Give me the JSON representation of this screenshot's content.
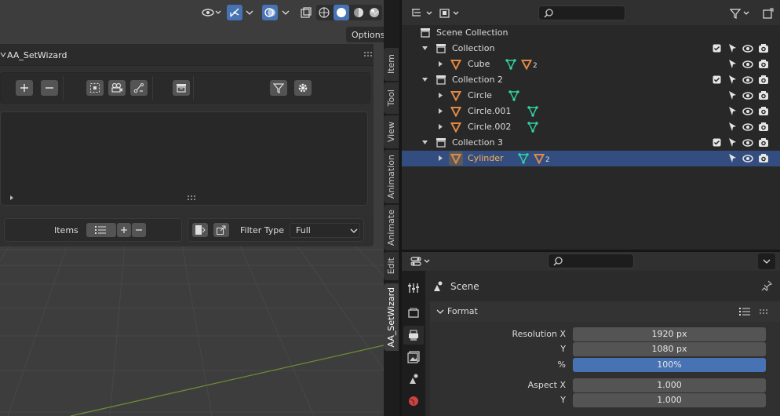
{
  "viewport": {
    "options_label": "Options",
    "panel_title": "AA_SetWizard",
    "items_label": "Items",
    "filter_type_label": "Filter Type",
    "filter_type_value": "Full"
  },
  "sidebar_tabs": [
    "Item",
    "Tool",
    "View",
    "Animation",
    "Animate",
    "Edit",
    "AA_SetWizard"
  ],
  "outliner": {
    "scene_collection": "Scene Collection",
    "rows": [
      {
        "label": "Collection",
        "type": "collection"
      },
      {
        "label": "Cube",
        "type": "object",
        "mesh_count": "2"
      },
      {
        "label": "Collection 2",
        "type": "collection"
      },
      {
        "label": "Circle",
        "type": "object"
      },
      {
        "label": "Circle.001",
        "type": "object"
      },
      {
        "label": "Circle.002",
        "type": "object"
      },
      {
        "label": "Collection 3",
        "type": "collection"
      },
      {
        "label": "Cylinder",
        "type": "object",
        "mesh_count": "2",
        "selected": true
      }
    ]
  },
  "properties": {
    "context_label": "Scene",
    "section_title": "Format",
    "fields": [
      {
        "label": "Resolution X",
        "value": "1920 px"
      },
      {
        "label": "Y",
        "value": "1080 px"
      },
      {
        "label": "%",
        "value": "100%",
        "highlight": true
      },
      {
        "label": "Aspect X",
        "value": "1.000"
      },
      {
        "label": "Y",
        "value": "1.000"
      }
    ]
  },
  "colors": {
    "accent_blue": "#4772b3",
    "selection": "#334d80",
    "object_orange": "#e08a45",
    "mesh_green": "#2fd4a4",
    "grid_line": "#6e8c36"
  }
}
